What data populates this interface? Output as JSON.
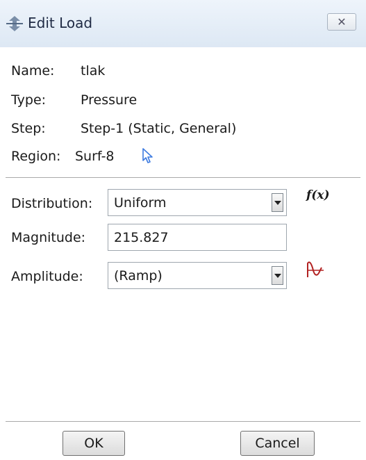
{
  "window": {
    "title": "Edit Load",
    "title_icon": "load-arrows-icon",
    "close_icon": "close-icon"
  },
  "info": {
    "name_label": "Name:",
    "name_value": "tlak",
    "type_label": "Type:",
    "type_value": "Pressure",
    "step_label": "Step:",
    "step_value": "Step-1 (Static, General)",
    "region_label": "Region:",
    "region_value": "Surf-8",
    "region_icon": "select-region-cursor-icon"
  },
  "form": {
    "distribution_label": "Distribution:",
    "distribution_value": "Uniform",
    "fx_label": "f(x)",
    "magnitude_label": "Magnitude:",
    "magnitude_value": "215.827",
    "amplitude_label": "Amplitude:",
    "amplitude_value": "(Ramp)",
    "amplitude_icon": "create-amplitude-icon"
  },
  "buttons": {
    "ok": "OK",
    "cancel": "Cancel"
  },
  "colors": {
    "titlebar": "#e6eef7",
    "cursor_icon": "#3d7be0",
    "amplitude_icon": "#b22222"
  }
}
